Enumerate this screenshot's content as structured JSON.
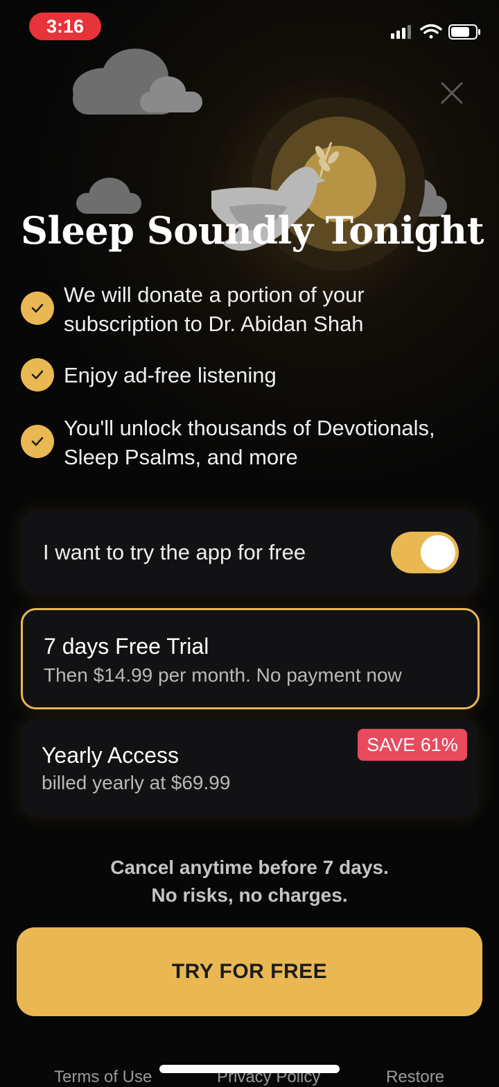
{
  "status_bar": {
    "time": "3:16",
    "icons": [
      "signal-icon",
      "wifi-icon",
      "battery-icon"
    ]
  },
  "header": {
    "close_icon": "close-icon",
    "title": "Sleep Soundly Tonight"
  },
  "benefits": [
    {
      "line1": "We will donate a portion of your",
      "line2": "subscription to Dr. Abidan Shah"
    },
    {
      "line1": "Enjoy ad-free listening",
      "line2": ""
    },
    {
      "line1": "You'll unlock thousands of Devotionals,",
      "line2": "Sleep Psalms, and more"
    }
  ],
  "free_trial_toggle": {
    "label": "I want to try the app for free",
    "on": true
  },
  "plans": [
    {
      "title": "7 days Free Trial",
      "subtitle": "Then $14.99 per month. No payment now",
      "selected": true
    },
    {
      "title": "Yearly Access",
      "subtitle": "billed yearly at $69.99",
      "badge": "SAVE 61%",
      "selected": false
    }
  ],
  "cancel_note": {
    "line1": "Cancel anytime before 7 days.",
    "line2": "No risks, no charges."
  },
  "cta": {
    "label": "TRY FOR FREE"
  },
  "footer": {
    "terms": "Terms of Use",
    "privacy": "Privacy Policy",
    "restore": "Restore"
  },
  "colors": {
    "accent": "#e9b852",
    "badge": "#ea4a5e",
    "background": "#070707",
    "card": "#121214"
  }
}
